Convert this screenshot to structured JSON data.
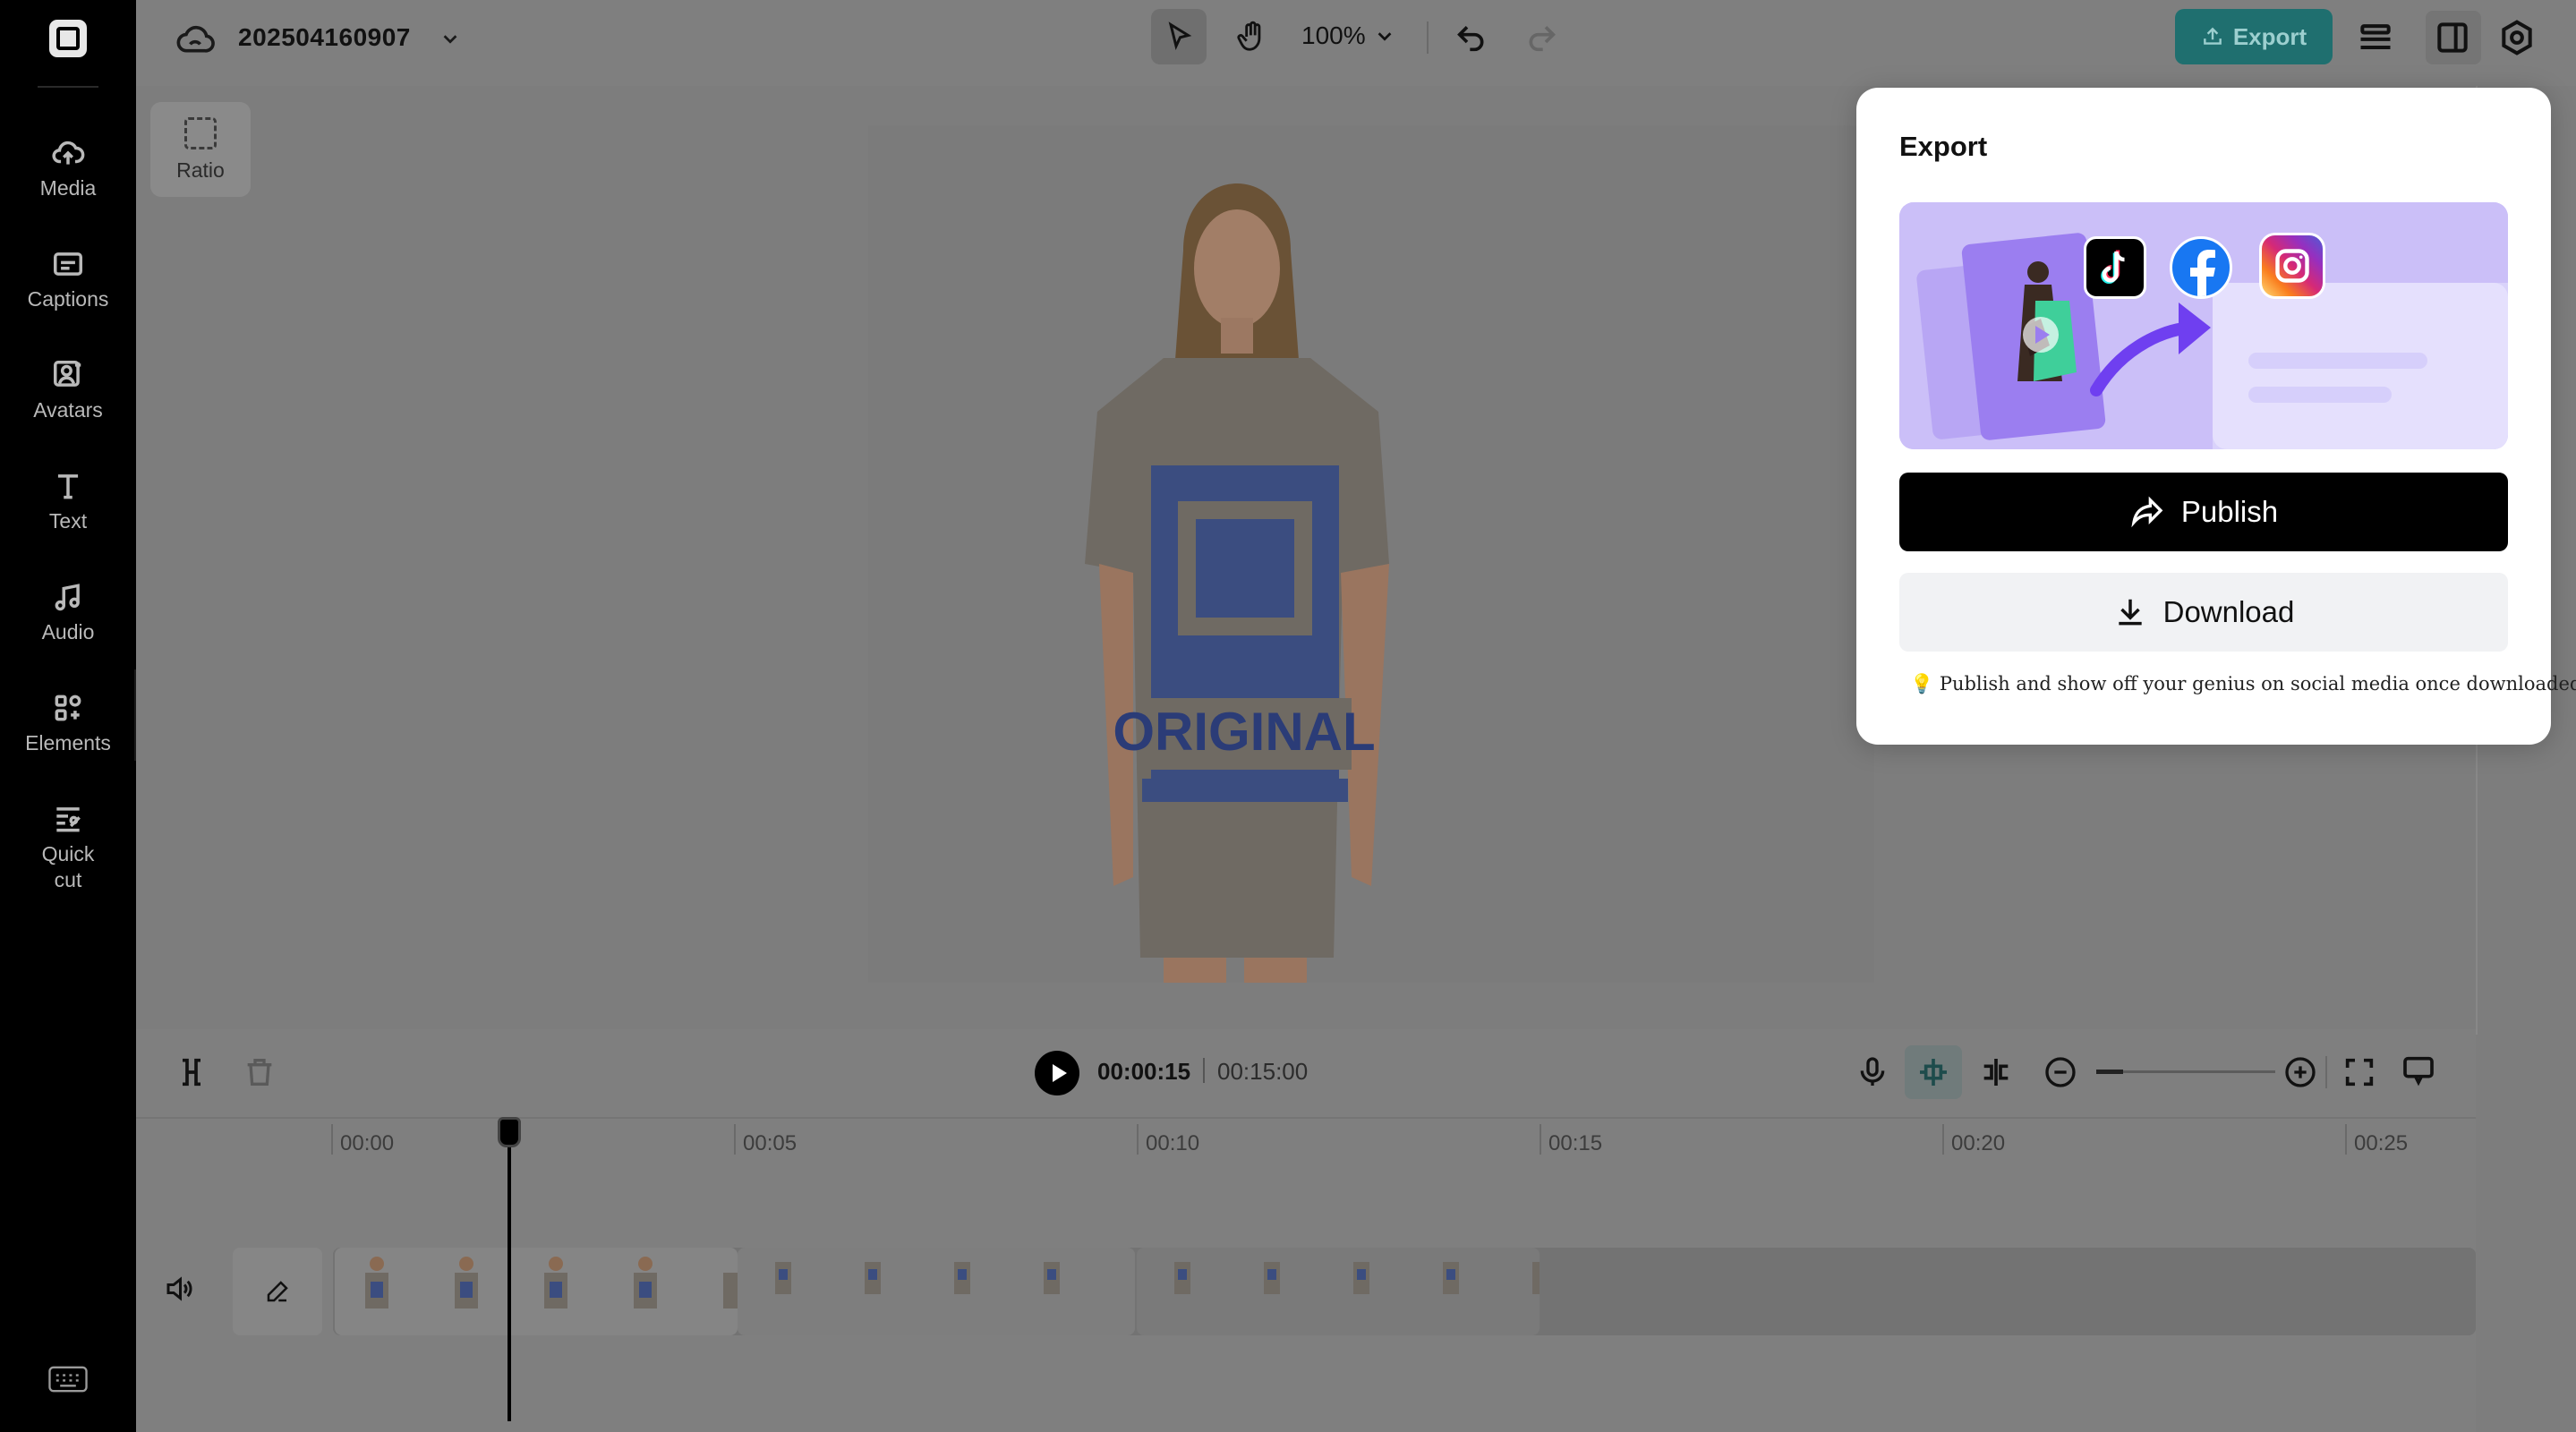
{
  "sidebar": {
    "items": [
      {
        "label": "Media",
        "icon": "cloud-upload-icon"
      },
      {
        "label": "Captions",
        "icon": "captions-icon"
      },
      {
        "label": "Avatars",
        "icon": "avatar-icon"
      },
      {
        "label": "Text",
        "icon": "text-icon"
      },
      {
        "label": "Audio",
        "icon": "music-note-icon"
      },
      {
        "label": "Elements",
        "icon": "elements-icon"
      },
      {
        "label": "Quick cut",
        "icon": "quick-cut-icon"
      }
    ]
  },
  "header": {
    "project_title": "202504160907",
    "zoom": "100%",
    "export_label": "Export"
  },
  "canvas": {
    "ratio_label": "Ratio"
  },
  "timeline": {
    "current_time": "00:00:15",
    "total_time": "00:15:00",
    "ruler": [
      "00:00",
      "00:05",
      "00:10",
      "00:15",
      "00:20",
      "00:25"
    ]
  },
  "export_popup": {
    "title": "Export",
    "publish_label": "Publish",
    "download_label": "Download",
    "hint": "💡 Publish and show off your genius on social media once downloaded.",
    "social_icons": [
      "tiktok-icon",
      "facebook-icon",
      "instagram-icon"
    ]
  },
  "colors": {
    "accent": "#1f6f6f",
    "publish_bg": "#000000",
    "banner_bg": "#d9d2fb",
    "shirt_print": "#1a3aa8"
  }
}
